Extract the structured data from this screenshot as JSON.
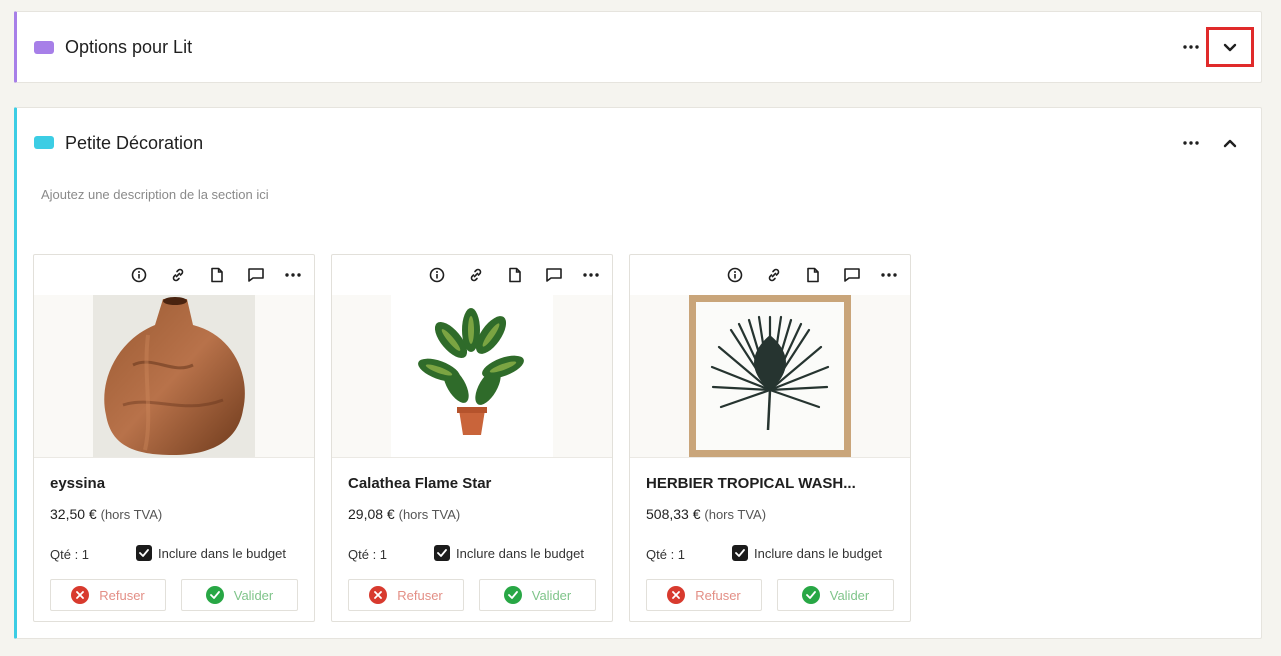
{
  "sections": [
    {
      "title": "Options pour Lit",
      "color": "#a77fe8",
      "toggle": "collapsed"
    },
    {
      "title": "Petite Décoration",
      "color": "#3ccde4",
      "toggle": "expanded",
      "description_placeholder": "Ajoutez une description de la section ici",
      "products": [
        {
          "name": "eyssina",
          "price": "32,50 €",
          "tax_note": "(hors TVA)",
          "qty_label": "Qté : 1",
          "budget_label": "Inclure dans le budget",
          "include_in_budget": true,
          "refuse_label": "Refuser",
          "validate_label": "Valider",
          "image": "wooden-vase"
        },
        {
          "name": "Calathea Flame Star",
          "price": "29,08 €",
          "tax_note": "(hors TVA)",
          "qty_label": "Qté : 1",
          "budget_label": "Inclure dans le budget",
          "include_in_budget": true,
          "refuse_label": "Refuser",
          "validate_label": "Valider",
          "image": "potted-plant"
        },
        {
          "name": "HERBIER TROPICAL WASH...",
          "price": "508,33 €",
          "tax_note": "(hors TVA)",
          "qty_label": "Qté : 1",
          "budget_label": "Inclure dans le budget",
          "include_in_budget": true,
          "refuse_label": "Refuser",
          "validate_label": "Valider",
          "image": "framed-palm-leaf"
        }
      ]
    }
  ],
  "card_tools": [
    "info-icon",
    "link-icon",
    "document-icon",
    "comment-icon",
    "more-icon"
  ],
  "colors": {
    "refuse": "#d83a2e",
    "validate": "#28a745",
    "highlight": "#e02a2a"
  }
}
